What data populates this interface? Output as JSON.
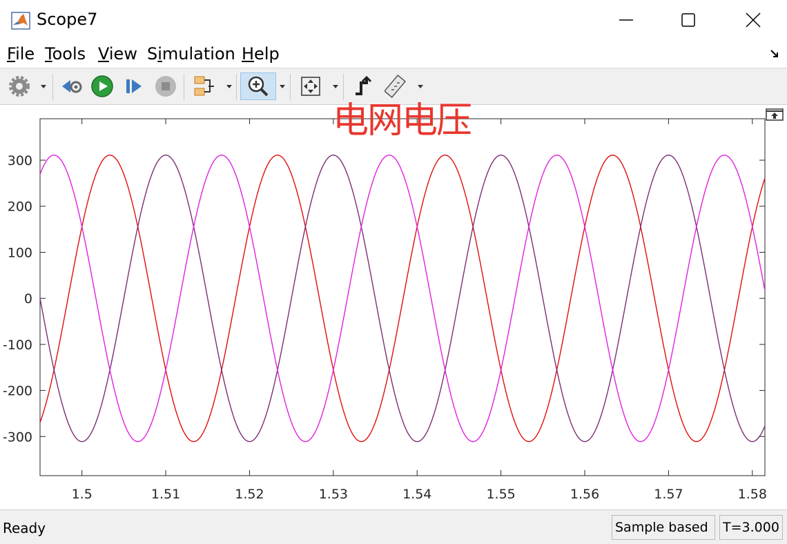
{
  "window": {
    "title": "Scope7",
    "minimize_icon": "minimize-icon",
    "maximize_icon": "maximize-icon",
    "close_icon": "close-icon"
  },
  "menu": [
    {
      "label": "File",
      "accel": "F"
    },
    {
      "label": "Tools",
      "accel": "T"
    },
    {
      "label": "View",
      "accel": "V"
    },
    {
      "label": "Simulation",
      "accel": "i"
    },
    {
      "label": "Help",
      "accel": "H"
    }
  ],
  "toolbar": {
    "items": [
      "settings-icon",
      "step-back-icon",
      "run-icon",
      "step-forward-icon",
      "stop-icon",
      "highlight-simulink-block-icon",
      "zoom-in-icon",
      "scale-axes-icon",
      "triggers-icon",
      "cursor-measurements-icon"
    ],
    "zoom_active": true
  },
  "chart_data": {
    "type": "line",
    "title": "电网电压",
    "xlabel": "",
    "ylabel": "",
    "xlim": [
      1.495,
      1.5815
    ],
    "ylim": [
      -385,
      390
    ],
    "x_ticks": [
      "1.5",
      "1.51",
      "1.52",
      "1.53",
      "1.54",
      "1.55",
      "1.56",
      "1.57",
      "1.58"
    ],
    "y_ticks": [
      "300",
      "200",
      "100",
      "0",
      "-100",
      "-200",
      "-300"
    ],
    "grid": false,
    "legend": "none",
    "series": [
      {
        "color": "#e00d0d",
        "amplitude": 311,
        "frequency_hz": 50,
        "phase_deg": 30
      },
      {
        "color": "#7a2e72",
        "amplitude": 311,
        "frequency_hz": 50,
        "phase_deg": -90
      },
      {
        "color": "#e020e0",
        "amplitude": 311,
        "frequency_hz": 50,
        "phase_deg": 150
      }
    ]
  },
  "status": {
    "left": "Ready",
    "mode": "Sample based",
    "time": "T=3.000"
  }
}
